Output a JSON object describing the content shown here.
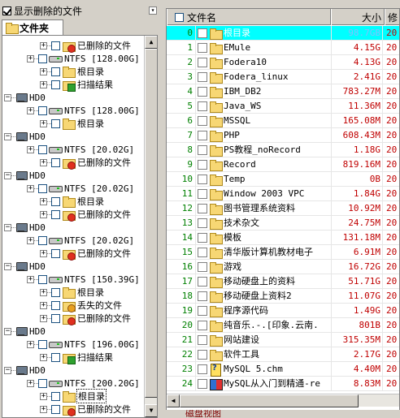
{
  "left_panel": {
    "show_deleted_label": "显示删除的文件",
    "show_deleted_checked": true,
    "folder_tab_label": "文件夹"
  },
  "tree": [
    {
      "kind": "child",
      "icon": "deleted-folder-icon",
      "label": "已删除的文件",
      "level": 3
    },
    {
      "kind": "child",
      "icon": "drive-icon",
      "label": "NTFS [128.00G]",
      "level": 2
    },
    {
      "kind": "child",
      "icon": "folder-icon",
      "label": "根目录",
      "level": 3
    },
    {
      "kind": "child",
      "icon": "scan-result-icon",
      "label": "扫描结果",
      "level": 3
    },
    {
      "kind": "disk",
      "label": "HD0"
    },
    {
      "kind": "child",
      "icon": "drive-icon",
      "label": "NTFS [128.00G]",
      "level": 2
    },
    {
      "kind": "child",
      "icon": "folder-icon",
      "label": "根目录",
      "level": 3
    },
    {
      "kind": "disk",
      "label": "HD0"
    },
    {
      "kind": "child",
      "icon": "drive-icon",
      "label": "NTFS [20.02G]",
      "level": 2
    },
    {
      "kind": "child",
      "icon": "deleted-folder-icon",
      "label": "已删除的文件",
      "level": 3
    },
    {
      "kind": "disk",
      "label": "HD0"
    },
    {
      "kind": "child",
      "icon": "drive-icon",
      "label": "NTFS [20.02G]",
      "level": 2
    },
    {
      "kind": "child",
      "icon": "folder-icon",
      "label": "根目录",
      "level": 3
    },
    {
      "kind": "child",
      "icon": "deleted-folder-icon",
      "label": "已删除的文件",
      "level": 3
    },
    {
      "kind": "disk",
      "label": "HD0"
    },
    {
      "kind": "child",
      "icon": "drive-icon",
      "label": "NTFS [20.02G]",
      "level": 2
    },
    {
      "kind": "child",
      "icon": "deleted-folder-icon",
      "label": "已删除的文件",
      "level": 3
    },
    {
      "kind": "disk",
      "label": "HD0"
    },
    {
      "kind": "child",
      "icon": "drive-icon",
      "label": "NTFS [150.39G]",
      "level": 2
    },
    {
      "kind": "child",
      "icon": "folder-icon",
      "label": "根目录",
      "level": 3
    },
    {
      "kind": "child",
      "icon": "lost-files-icon",
      "label": "丢失的文件",
      "level": 3
    },
    {
      "kind": "child",
      "icon": "deleted-folder-icon",
      "label": "已删除的文件",
      "level": 3
    },
    {
      "kind": "disk",
      "label": "HD0"
    },
    {
      "kind": "child",
      "icon": "drive-icon",
      "label": "NTFS [196.00G]",
      "level": 2
    },
    {
      "kind": "child",
      "icon": "scan-result-icon",
      "label": "扫描结果",
      "level": 3
    },
    {
      "kind": "disk",
      "label": "HD0"
    },
    {
      "kind": "child",
      "icon": "drive-icon",
      "label": "NTFS [200.20G]",
      "level": 2
    },
    {
      "kind": "child",
      "icon": "folder-icon",
      "label": "根目录",
      "level": 3,
      "selected": true
    },
    {
      "kind": "child",
      "icon": "deleted-folder-icon",
      "label": "已删除的文件",
      "level": 3
    }
  ],
  "file_list": {
    "columns": {
      "name": "文件名",
      "size": "大小",
      "modified": "修"
    },
    "rows": [
      {
        "no": "0",
        "icon": "folder-icon",
        "name": "根目录",
        "size": "98.7GB",
        "mod": "20",
        "selected": true
      },
      {
        "no": "1",
        "icon": "folder-icon",
        "name": "EMule",
        "size": "4.15G",
        "mod": "20"
      },
      {
        "no": "2",
        "icon": "folder-icon",
        "name": "Fodera10",
        "size": "4.13G",
        "mod": "20"
      },
      {
        "no": "3",
        "icon": "folder-icon",
        "name": "Fodera_linux",
        "size": "2.41G",
        "mod": "20"
      },
      {
        "no": "4",
        "icon": "folder-icon",
        "name": "IBM_DB2",
        "size": "783.27M",
        "mod": "20"
      },
      {
        "no": "5",
        "icon": "folder-icon",
        "name": "Java_WS",
        "size": "11.36M",
        "mod": "20"
      },
      {
        "no": "6",
        "icon": "folder-icon",
        "name": "MSSQL",
        "size": "165.08M",
        "mod": "20"
      },
      {
        "no": "7",
        "icon": "folder-icon",
        "name": "PHP",
        "size": "608.43M",
        "mod": "20"
      },
      {
        "no": "8",
        "icon": "folder-icon",
        "name": "PS教程_noRecord",
        "size": "1.18G",
        "mod": "20"
      },
      {
        "no": "9",
        "icon": "folder-icon",
        "name": "Record",
        "size": "819.16M",
        "mod": "20"
      },
      {
        "no": "10",
        "icon": "folder-icon",
        "name": "Temp",
        "size": "0B",
        "mod": "20"
      },
      {
        "no": "11",
        "icon": "folder-icon",
        "name": "Window 2003 VPC",
        "size": "1.84G",
        "mod": "20"
      },
      {
        "no": "12",
        "icon": "folder-icon",
        "name": "图书管理系统资料",
        "size": "10.92M",
        "mod": "20"
      },
      {
        "no": "13",
        "icon": "folder-icon",
        "name": "技术杂文",
        "size": "24.75M",
        "mod": "20"
      },
      {
        "no": "14",
        "icon": "folder-icon",
        "name": "模板",
        "size": "131.18M",
        "mod": "20"
      },
      {
        "no": "15",
        "icon": "folder-icon",
        "name": "清华版计算机教材电子",
        "size": "6.91M",
        "mod": "20"
      },
      {
        "no": "16",
        "icon": "folder-icon",
        "name": "游戏",
        "size": "16.72G",
        "mod": "20"
      },
      {
        "no": "17",
        "icon": "folder-icon",
        "name": "移动硬盘上的资料",
        "size": "51.71G",
        "mod": "20"
      },
      {
        "no": "18",
        "icon": "folder-icon",
        "name": "移动硬盘上资料2",
        "size": "11.07G",
        "mod": "20"
      },
      {
        "no": "19",
        "icon": "folder-icon",
        "name": "程序源代码",
        "size": "1.49G",
        "mod": "20"
      },
      {
        "no": "20",
        "icon": "folder-icon",
        "name": "纯音乐.-.[印象.云南.",
        "size": "801B",
        "mod": "20"
      },
      {
        "no": "21",
        "icon": "folder-icon",
        "name": "网站建设",
        "size": "315.35M",
        "mod": "20"
      },
      {
        "no": "22",
        "icon": "folder-icon",
        "name": "软件工具",
        "size": "2.17G",
        "mod": "20"
      },
      {
        "no": "23",
        "icon": "chm-file-icon",
        "name": "MySQL 5.chm",
        "size": "4.40M",
        "mod": "20"
      },
      {
        "no": "24",
        "icon": "exe-file-icon",
        "name": "MySQL从入门到精通-re",
        "size": "8.83M",
        "mod": "20"
      }
    ]
  },
  "bottom_tab_label": "磁盘视图"
}
